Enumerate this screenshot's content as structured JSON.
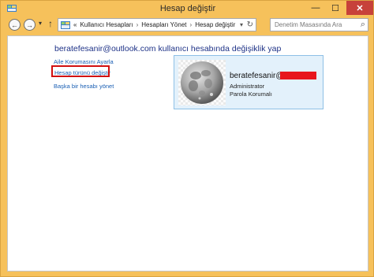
{
  "window": {
    "title": "Hesap değiştir",
    "controls": {
      "minimize": "—",
      "maximize": "☐",
      "close": "✕"
    }
  },
  "nav": {
    "back": "←",
    "forward": "→",
    "recent": "▾",
    "up": "↑",
    "breadcrumb_prefix": "«",
    "breadcrumb": [
      "Kullanıcı Hesapları",
      "Hesapları Yönet",
      "Hesap değiştir"
    ],
    "separator": "›",
    "dropdown": "▾",
    "refresh": "↻",
    "search_placeholder": "Denetim Masasında Ara",
    "search_icon": "⌕"
  },
  "main": {
    "heading": "beratefesanir@outlook.com kullanıcı hesabında değişiklik yap",
    "links": [
      "Aile Korumasını Ayarla",
      "Hesap türünü değiştir",
      "Başka bir hesabı yönet"
    ],
    "highlight_color": "#d21010"
  },
  "account": {
    "name": "beratefesanir@",
    "redaction_color": "#e8161c",
    "role": "Administrator",
    "protection": "Parola Korumalı",
    "avatar_icon": "moon-photo"
  },
  "colors": {
    "window_frame": "#f6c15b",
    "link": "#1a5fb4",
    "heading": "#1e3287",
    "card_bg": "#e3f1fb",
    "close_button": "#c7413a"
  }
}
